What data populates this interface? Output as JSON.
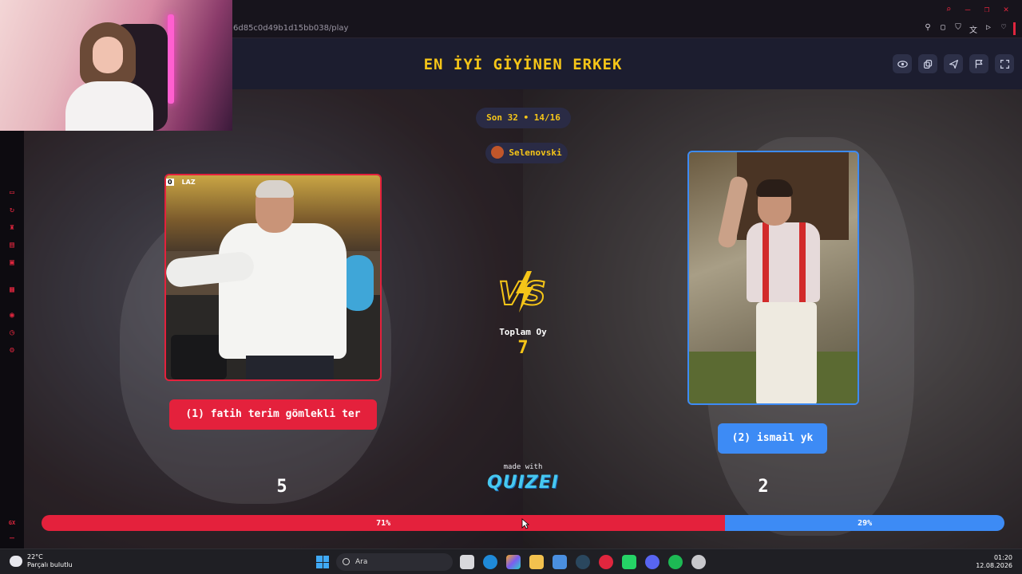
{
  "browser": {
    "url": "6d85c0d49b1d15bb038/play",
    "sidebar_label": "GX"
  },
  "quiz": {
    "title": "EN İYİ GİYİNEN ERKEK",
    "round": "Son 32 • 14/16",
    "username": "Selenovski",
    "left": {
      "channel_badge": "0",
      "channel_logo": "LAZ",
      "name": "(1) fatih terim gömlekli ter",
      "votes": "5",
      "percent_label": "71%",
      "percent": 71
    },
    "right": {
      "name": "(2) ismail yk",
      "votes": "2",
      "percent_label": "29%",
      "percent": 29
    },
    "vs_label": "VS",
    "total_label": "Toplam Oy",
    "total_value": "7",
    "made_with": "made with",
    "brand": "QUIZEI"
  },
  "header_icons": [
    "eye-icon",
    "copy-icon",
    "send-icon",
    "flag-icon",
    "fullscreen-icon"
  ],
  "colors": {
    "accent_yellow": "#f5c518",
    "left_red": "#e4213c",
    "right_blue": "#3d8bf5",
    "header_bg": "#1c1d2f"
  },
  "taskbar": {
    "temperature": "22°C",
    "weather": "Parçalı bulutlu",
    "search_placeholder": "Ara",
    "time": "01:20",
    "date": "12.08.2026"
  }
}
